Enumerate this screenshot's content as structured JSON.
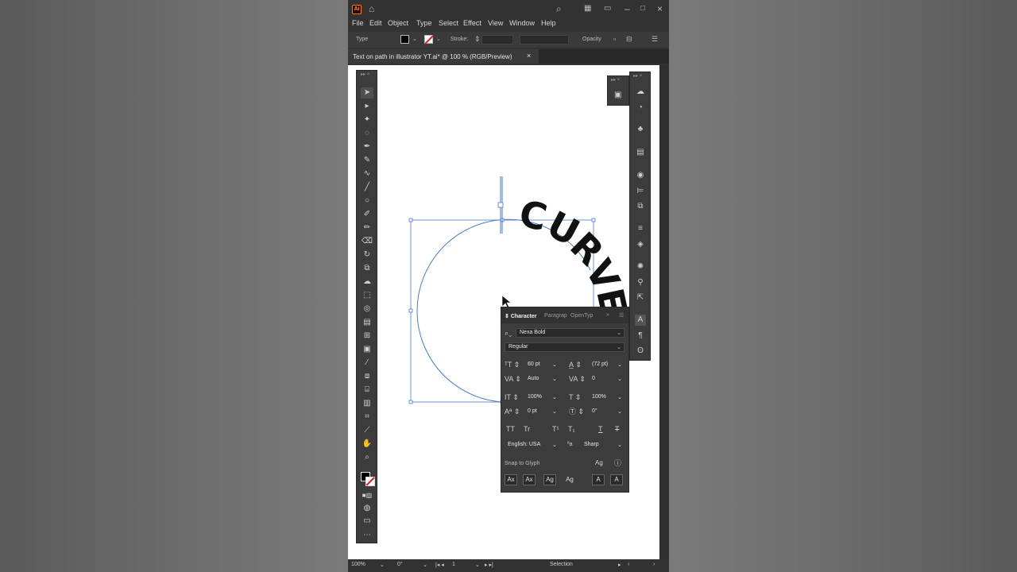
{
  "app": {
    "logo": "Ai",
    "menu": [
      "File",
      "Edit",
      "Object",
      "Type",
      "Select",
      "Effect",
      "View",
      "Window",
      "Help"
    ]
  },
  "control_bar": {
    "type_label": "Type",
    "stroke_label": "Stroke:",
    "opacity_label": "Opacity"
  },
  "document_tab": {
    "title": "Text on path in illustrator YT.ai* @ 100 % (RGB/Preview)",
    "close": "×"
  },
  "artwork": {
    "curved_text": "CURVE",
    "letters": [
      "C",
      "U",
      "R",
      "V",
      "E"
    ],
    "path_color": "#4a79c8",
    "text_color": "#111111"
  },
  "character_panel": {
    "tabs": [
      "Character",
      "Paragrap",
      "OpenTyp"
    ],
    "font_family": "Nexa Bold",
    "font_style": "Regular",
    "font_size": "60 pt",
    "leading": "(72 pt)",
    "kerning": "Auto",
    "tracking": "0",
    "vertical_scale": "100%",
    "horizontal_scale": "100%",
    "baseline_shift": "0 pt",
    "rotation": "0°",
    "text_style_buttons": [
      "TT",
      "Tr",
      "T¹",
      "T₁",
      "T",
      "T"
    ],
    "language": "English: USA",
    "antialias": "Sharp",
    "snap_label": "Snap to Glyph",
    "snap_buttons": [
      "Ax",
      "Ax",
      "Ag",
      "Ag",
      "A",
      "A"
    ]
  },
  "status_bar": {
    "zoom": "100%",
    "rotation": "0°",
    "artboard": "1",
    "tool": "Selection"
  },
  "colors": {
    "ui_dark": "#323232",
    "panel": "#3c3c3c",
    "accent_orange": "#ff9a00",
    "stroke_none_red": "#e02020"
  }
}
